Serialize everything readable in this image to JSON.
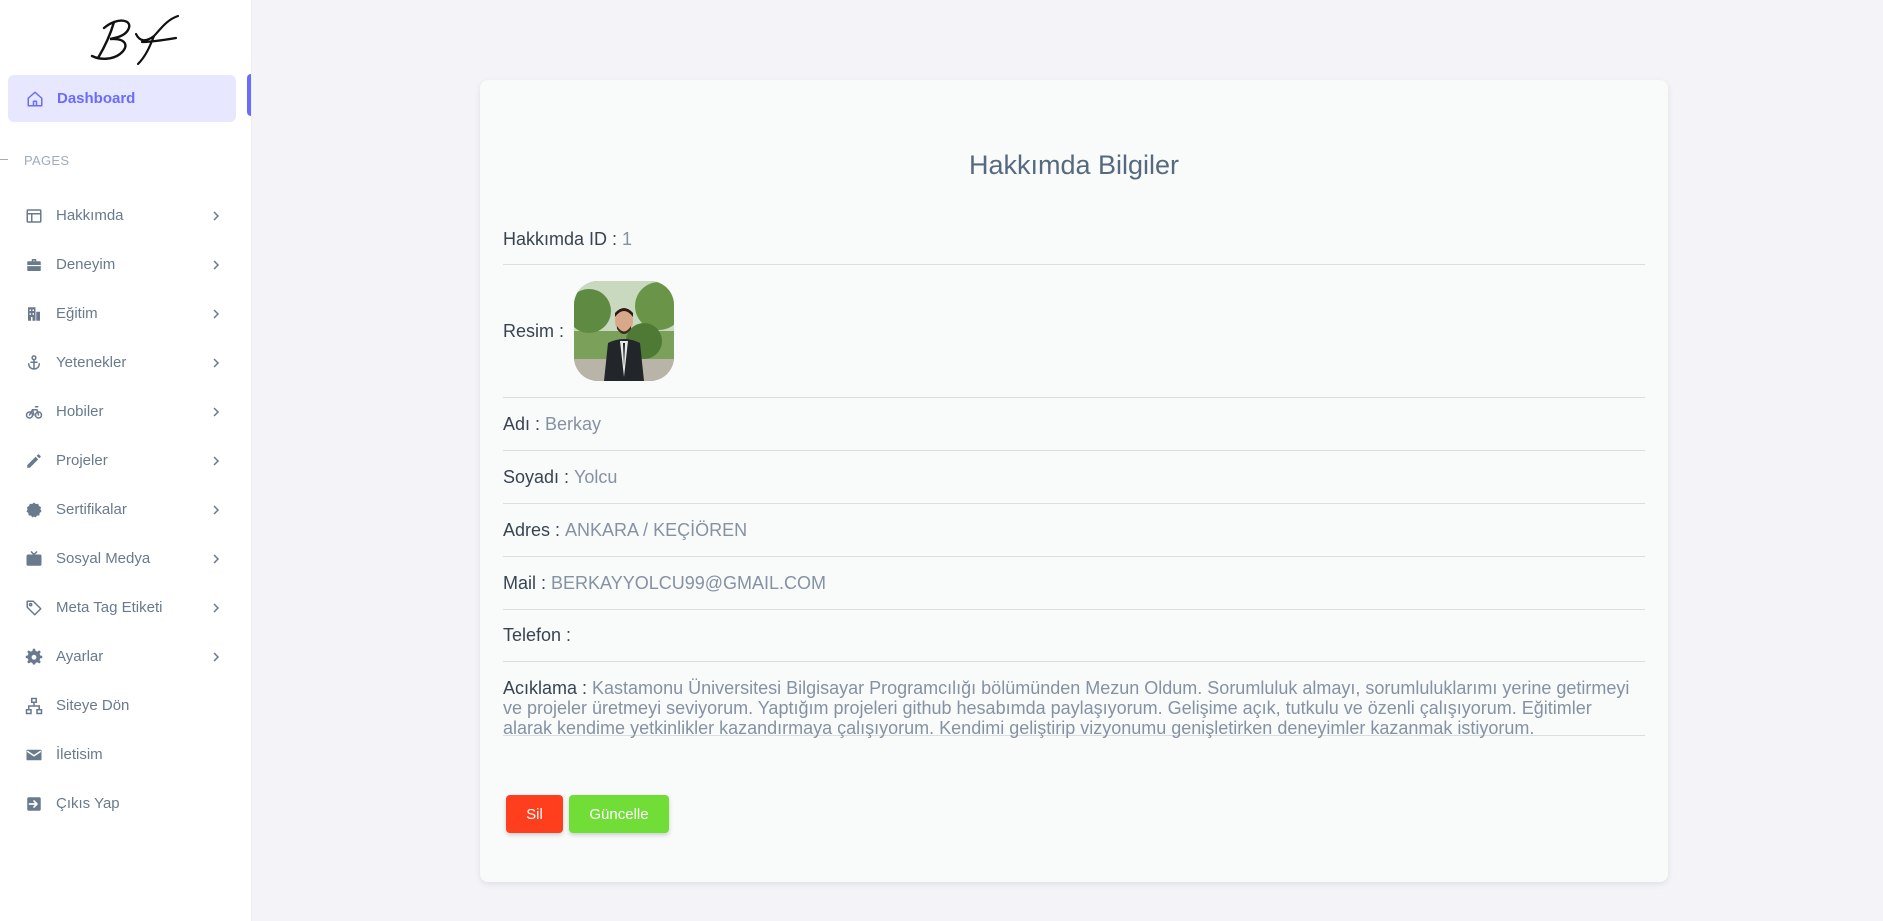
{
  "sidebar": {
    "logo_text": "BY",
    "active_item": {
      "label": "Dashboard",
      "icon": "home-icon"
    },
    "section_label": "PAGES",
    "items": [
      {
        "label": "Hakkımda",
        "icon": "layout-icon",
        "has_submenu": true
      },
      {
        "label": "Deneyim",
        "icon": "briefcase-icon",
        "has_submenu": true
      },
      {
        "label": "Eğitim",
        "icon": "building-icon",
        "has_submenu": true
      },
      {
        "label": "Yetenekler",
        "icon": "anchor-icon",
        "has_submenu": true
      },
      {
        "label": "Hobiler",
        "icon": "bicycle-icon",
        "has_submenu": true
      },
      {
        "label": "Projeler",
        "icon": "pencil-icon",
        "has_submenu": true
      },
      {
        "label": "Sertifikalar",
        "icon": "badge-icon",
        "has_submenu": true
      },
      {
        "label": "Sosyal Medya",
        "icon": "tv-icon",
        "has_submenu": true
      },
      {
        "label": "Meta Tag Etiketi",
        "icon": "tag-icon",
        "has_submenu": true
      },
      {
        "label": "Ayarlar",
        "icon": "gear-icon",
        "has_submenu": true
      },
      {
        "label": "Siteye Dön",
        "icon": "sitemap-icon",
        "has_submenu": false
      },
      {
        "label": "İletisim",
        "icon": "mail-icon",
        "has_submenu": false
      },
      {
        "label": "Çıkıs Yap",
        "icon": "logout-icon",
        "has_submenu": false
      }
    ]
  },
  "card": {
    "title": "Hakkımda Bilgiler",
    "fields": {
      "id": {
        "label": "Hakkımda ID : ",
        "value": "1"
      },
      "image": {
        "label": "Resim : "
      },
      "first_name": {
        "label": "Adı : ",
        "value": "Berkay"
      },
      "last_name": {
        "label": "Soyadı : ",
        "value": "Yolcu"
      },
      "address": {
        "label": "Adres : ",
        "value": "ANKARA / KEÇİÖREN"
      },
      "mail": {
        "label": "Mail : ",
        "value": "BERKAYYOLCU99@GMAIL.COM"
      },
      "phone": {
        "label": "Telefon : ",
        "value": ""
      },
      "description": {
        "label": "Acıklama : ",
        "value": "Kastamonu Üniversitesi Bilgisayar Programcılığı bölümünden Mezun Oldum. Sorumluluk almayı, sorumluluklarımı yerine getirmeyi ve projeler üretmeyi seviyorum. Yaptığım projeleri github hesabımda paylaşıyorum. Gelişime açık, tutkulu ve özenli çalışıyorum. Eğitimler alarak kendime yetkinlikler kazandırmaya çalışıyorum. Kendimi geliştirip vizyonumu genişletirken deneyimler kazanmak istiyorum."
      }
    },
    "buttons": {
      "delete": "Sil",
      "update": "Güncelle"
    }
  },
  "colors": {
    "accent": "#696cff",
    "delete": "#ff3e1d",
    "update": "#71dd37"
  }
}
